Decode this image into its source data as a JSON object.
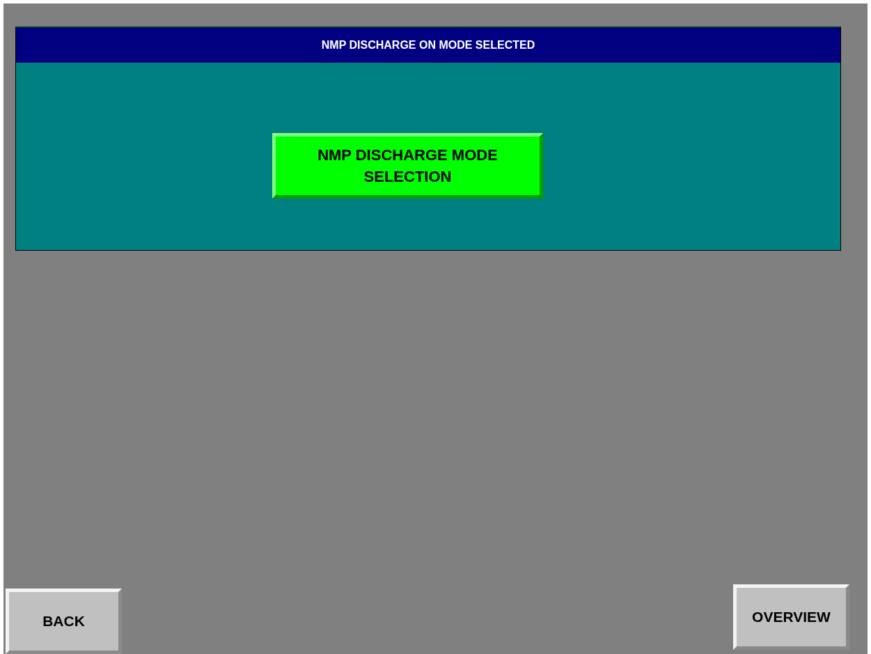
{
  "panel": {
    "title": "NMP DISCHARGE ON MODE SELECTED",
    "buttons": [
      {
        "label": "NMP DISCHARGE MODE SELECTION",
        "kind": "green"
      }
    ]
  },
  "nav_buttons": [
    {
      "label": "BACK"
    },
    {
      "label": "OVERVIEW"
    }
  ]
}
